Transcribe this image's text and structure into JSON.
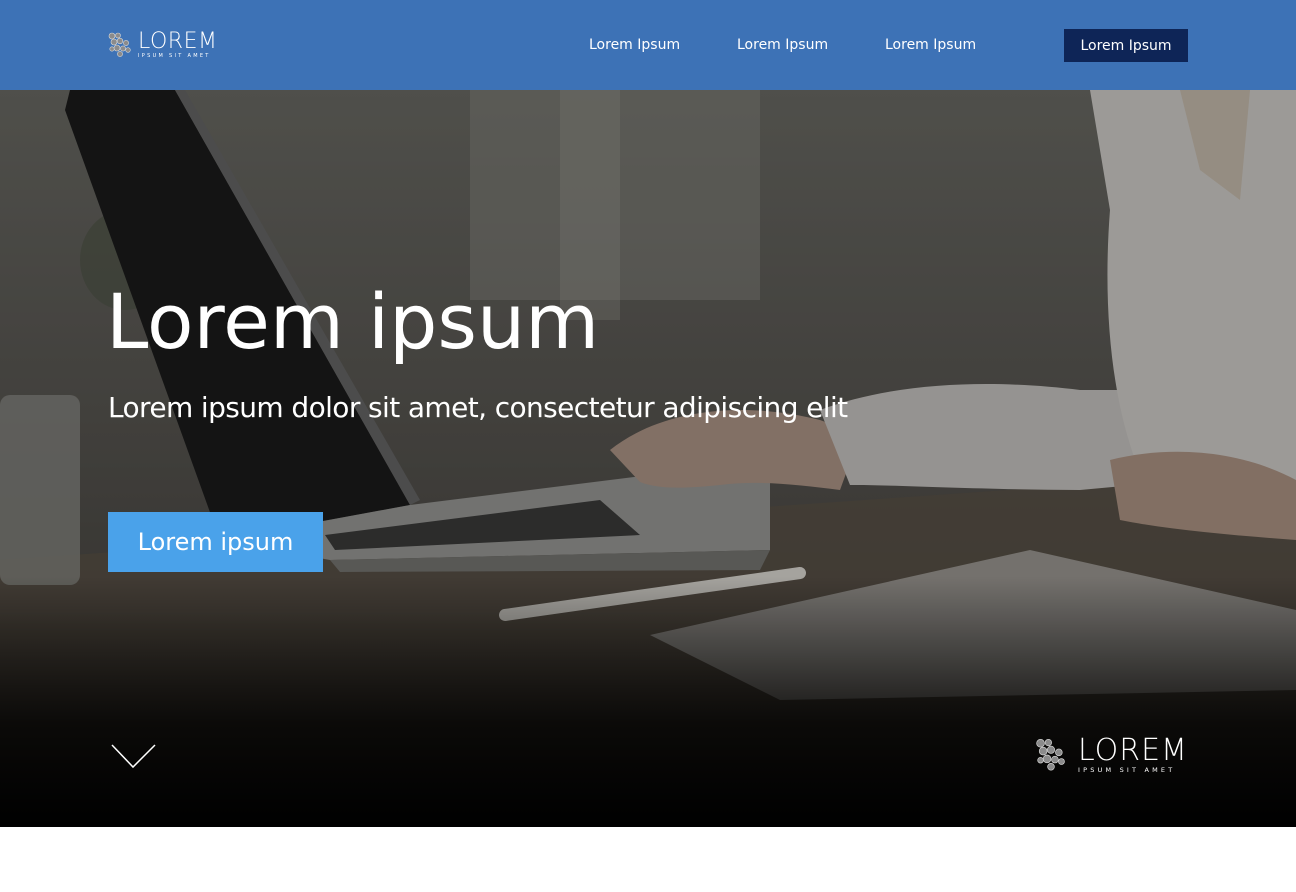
{
  "header": {
    "logo": {
      "word": "LOREM",
      "tagline": "IPSUM SIT AMET"
    },
    "nav": [
      {
        "label": "Lorem Ipsum"
      },
      {
        "label": "Lorem Ipsum"
      },
      {
        "label": "Lorem Ipsum"
      }
    ],
    "cta": {
      "label": "Lorem Ipsum"
    }
  },
  "hero": {
    "title": "Lorem ipsum",
    "subtitle": "Lorem ipsum dolor sit amet, consectetur adipiscing elit",
    "button": {
      "label": "Lorem ipsum"
    },
    "scroll_icon": "chevron-down-icon",
    "footer_logo": {
      "word": "LOREM",
      "tagline": "IPSUM SIT AMET"
    }
  },
  "colors": {
    "navbar": "#3d72b6",
    "nav_cta": "#0e2557",
    "hero_button": "#4aa2ea",
    "text": "#ffffff"
  }
}
